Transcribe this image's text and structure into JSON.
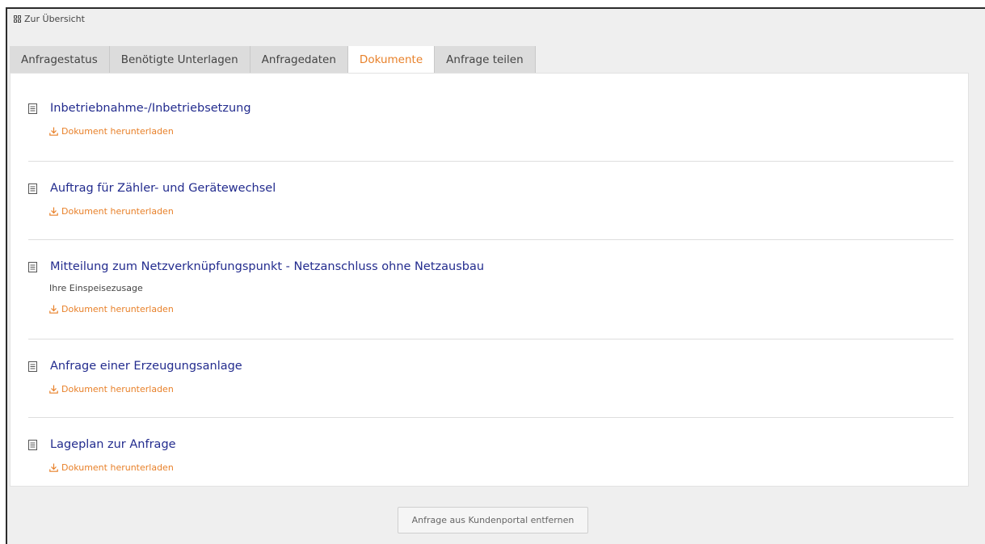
{
  "nav": {
    "back_label": "Zur Übersicht"
  },
  "tabs": [
    {
      "label": "Anfragestatus",
      "active": false
    },
    {
      "label": "Benötigte Unterlagen",
      "active": false
    },
    {
      "label": "Anfragedaten",
      "active": false
    },
    {
      "label": "Dokumente",
      "active": true
    },
    {
      "label": "Anfrage teilen",
      "active": false
    }
  ],
  "documents": [
    {
      "title": "Inbetriebnahme-/Inbetriebsetzung",
      "subtitle": "",
      "download_label": "Dokument herunterladen"
    },
    {
      "title": "Auftrag für Zähler- und Gerätewechsel",
      "subtitle": "",
      "download_label": "Dokument herunterladen"
    },
    {
      "title": "Mitteilung zum Netzverknüpfungspunkt - Netzanschluss ohne Netzausbau",
      "subtitle": "Ihre Einspeisezusage",
      "download_label": "Dokument herunterladen"
    },
    {
      "title": "Anfrage einer Erzeugungsanlage",
      "subtitle": "",
      "download_label": "Dokument herunterladen"
    },
    {
      "title": "Lageplan zur Anfrage",
      "subtitle": "",
      "download_label": "Dokument herunterladen"
    }
  ],
  "footer": {
    "remove_label": "Anfrage aus Kundenportal entfernen"
  },
  "colors": {
    "accent": "#e8812a",
    "link": "#232c8e",
    "background": "#efefef"
  }
}
